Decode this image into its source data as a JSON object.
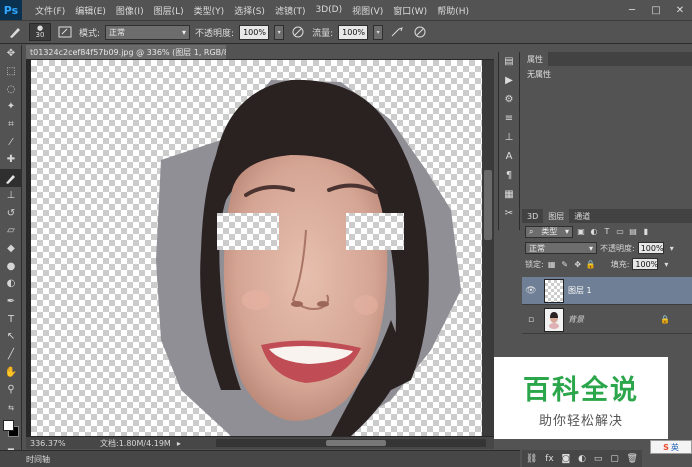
{
  "app": {
    "logo": "Ps"
  },
  "menu": [
    "文件(F)",
    "编辑(E)",
    "图像(I)",
    "图层(L)",
    "类型(Y)",
    "选择(S)",
    "滤镜(T)",
    "3D(D)",
    "视图(V)",
    "窗口(W)",
    "帮助(H)"
  ],
  "window_controls": {
    "minimize": "─",
    "maximize": "□",
    "close": "✕"
  },
  "options": {
    "brush_size": "30",
    "mode_label": "模式:",
    "mode_value": "正常",
    "opacity_label": "不透明度:",
    "opacity_value": "100%",
    "flow_label": "流量:",
    "flow_value": "100%"
  },
  "document": {
    "tab_title": "t01324c2cef84f57b09.jpg @ 336% (图层 1, RGB/8#) *",
    "zoom": "336.37%",
    "doc_size": "文档:1.80M/4.19M"
  },
  "timeline": {
    "label": "时间轴"
  },
  "properties": {
    "tab": "属性",
    "empty": "无属性"
  },
  "layers": {
    "tabs": [
      "3D",
      "图层",
      "通道"
    ],
    "filter_type": "类型",
    "blend_mode": "正常",
    "opacity_label": "不透明度:",
    "opacity_value": "100%",
    "lock_label": "锁定:",
    "fill_label": "填充:",
    "fill_value": "100%",
    "items": [
      {
        "name": "图层 1",
        "visible": true,
        "selected": true
      },
      {
        "name": "背景",
        "visible": false,
        "selected": false,
        "locked": true
      }
    ]
  },
  "watermark": {
    "title": "百科全说",
    "subtitle": "助你轻松解决"
  },
  "ime": {
    "label": "英"
  }
}
